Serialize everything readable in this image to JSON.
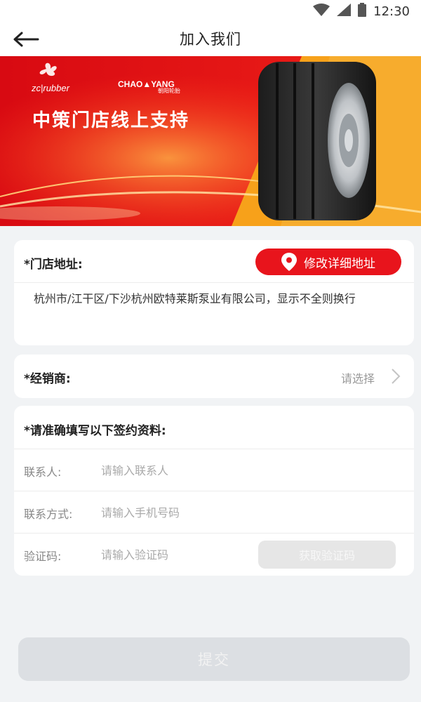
{
  "status_bar": {
    "time": "12:30",
    "icons": [
      "wifi-icon",
      "signal-icon",
      "battery-icon"
    ]
  },
  "header": {
    "title": "加入我们",
    "back_icon": "arrow-left-icon"
  },
  "banner": {
    "brand_left": "zc|rubber",
    "brand_right": "CHAO▲YANG",
    "brand_right_sub": "朝阳轮胎",
    "headline": "中策门店线上支持",
    "colors": {
      "red": "#e8141c",
      "orange": "#f7a11a",
      "dark_red": "#c30d12"
    }
  },
  "address_card": {
    "label": "*门店地址:",
    "edit_button": "修改详细地址",
    "edit_icon": "location-pin-icon",
    "address_text": "杭州市/江干区/下沙杭州欧特莱斯泵业有限公司，显示不全则换行"
  },
  "dealer_card": {
    "label": "*经销商:",
    "value": "请选择",
    "chevron_icon": "chevron-right-icon"
  },
  "form_card": {
    "title": "*请准确填写以下签约资料:",
    "fields": [
      {
        "label": "联系人:",
        "placeholder": "请输入联系人",
        "value": ""
      },
      {
        "label": "联系方式:",
        "placeholder": "请输入手机号码",
        "value": ""
      },
      {
        "label": "验证码:",
        "placeholder": "请输入验证码",
        "value": ""
      }
    ],
    "code_button": "获取验证码"
  },
  "submit_button": "提交",
  "accent_color": "#e8141c"
}
